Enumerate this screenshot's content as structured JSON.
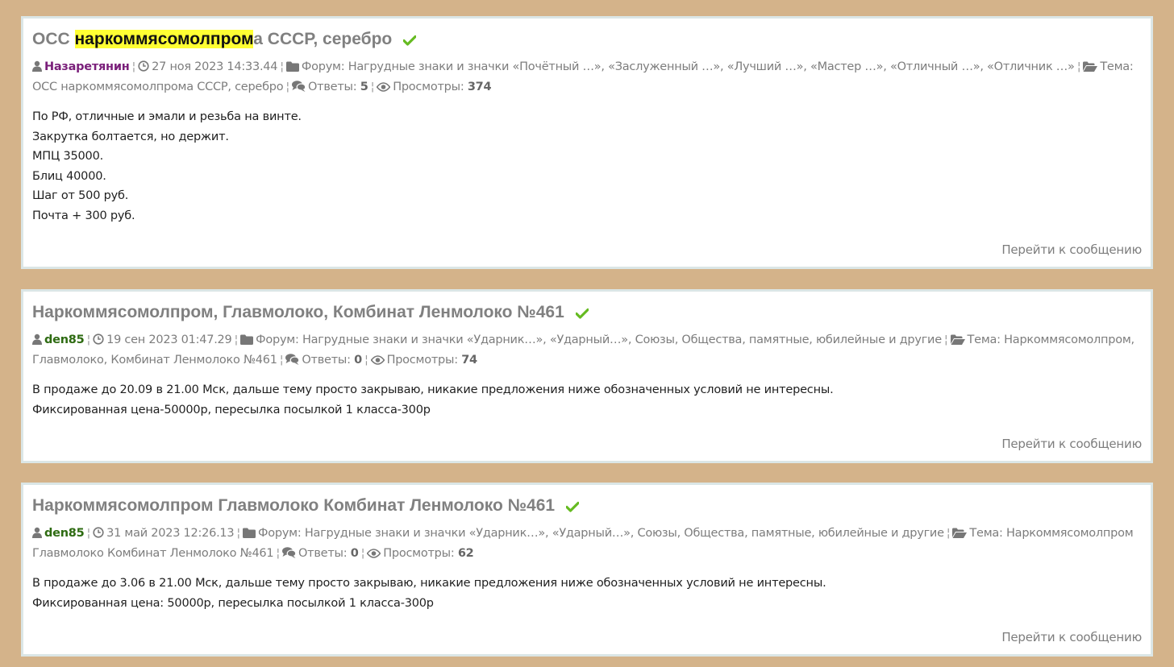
{
  "posts": [
    {
      "title_pre": "ОСС ",
      "title_hl": "наркоммясомолпром",
      "title_post": "а СССР, серебро",
      "author": "Назаретянин",
      "date": "27 ноя 2023 14:33.44",
      "forum_label": "Форум:",
      "forum": "Нагрудные знаки и значки «Почётный …», «Заслуженный …», «Лучший …», «Мастер …», «Отличный …», «Отличник …»",
      "topic_label": "Тема:",
      "topic": "ОСС наркоммясомолпрома СССР, серебро",
      "replies_label": "Ответы:",
      "replies": "5",
      "views_label": "Просмотры:",
      "views": "374",
      "lines": [
        "По РФ, отличные и эмали и резьба на винте.",
        "Закрутка болтается, но держит.",
        "МПЦ 35000.",
        "Блиц 40000.",
        "Шаг от 500 руб.",
        "Почта + 300 руб."
      ],
      "link": "Перейти к сообщению"
    },
    {
      "title": "Наркоммясомолпром, Главмолоко, Комбинат Ленмолоко №461",
      "author": "den85",
      "date": "19 сен 2023 01:47.29",
      "forum_label": "Форум:",
      "forum": "Нагрудные знаки и значки «Ударник…», «Ударный…», Союзы, Общества, памятные, юбилейные и другие",
      "topic_label": "Тема:",
      "topic": "Наркоммясомолпром, Главмолоко, Комбинат Ленмолоко №461",
      "replies_label": "Ответы:",
      "replies": "0",
      "views_label": "Просмотры:",
      "views": "74",
      "lines": [
        "В продаже до 20.09 в 21.00 Мск, дальше тему просто закрываю, никакие предложения ниже обозначенных условий не интересны.",
        "Фиксированная цена-50000р, пересылка посылкой 1 класса-300р"
      ],
      "link": "Перейти к сообщению"
    },
    {
      "title": "Наркоммясомолпром Главмолоко Комбинат Ленмолоко №461",
      "author": "den85",
      "date": "31 май 2023 12:26.13",
      "forum_label": "Форум:",
      "forum": "Нагрудные знаки и значки «Ударник…», «Ударный…», Союзы, Общества, памятные, юбилейные и другие",
      "topic_label": "Тема:",
      "topic": "Наркоммясомолпром Главмолоко Комбинат Ленмолоко №461",
      "replies_label": "Ответы:",
      "replies": "0",
      "views_label": "Просмотры:",
      "views": "62",
      "lines": [
        "В продаже до 3.06 в 21.00 Мск, дальше тему просто закрываю, никакие предложения ниже обозначенных условий не интересны.",
        "Фиксированная цена: 50000р, пересылка посылкой 1 класса-300р"
      ],
      "link": "Перейти к сообщению"
    }
  ],
  "colors": {
    "background": "#d4b38a",
    "highlight": "#ffff33",
    "check": "#66bb22",
    "author_primary": "#7a1f7a",
    "author_secondary": "#2e6b12"
  },
  "icons": [
    "user-icon",
    "clock-icon",
    "folder-icon",
    "folder-open-icon",
    "comments-icon",
    "eye-icon",
    "check-icon"
  ]
}
